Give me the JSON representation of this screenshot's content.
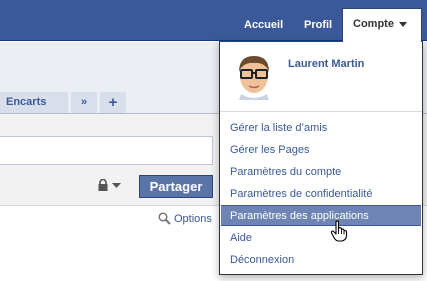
{
  "topbar": {
    "accueil": "Accueil",
    "profil": "Profil",
    "compte": "Compte"
  },
  "tabs": {
    "encarts": "Encarts",
    "more": "»",
    "add": "+"
  },
  "composer": {
    "share_label": "Partager",
    "options_label": "Options"
  },
  "dropdown": {
    "user_name": "Laurent Martin",
    "items": [
      {
        "label": "Gérer la liste d’amis"
      },
      {
        "label": "Gérer les Pages"
      },
      {
        "label": "Paramètres du compte"
      },
      {
        "label": "Paramètres de confidentialité"
      },
      {
        "label": "Paramètres des applications",
        "active": true
      },
      {
        "label": "Aide"
      },
      {
        "label": "Déconnexion"
      }
    ]
  },
  "colors": {
    "brand_blue": "#3b5998",
    "highlight": "#6d84b4",
    "share_button": "#5b74a8"
  }
}
